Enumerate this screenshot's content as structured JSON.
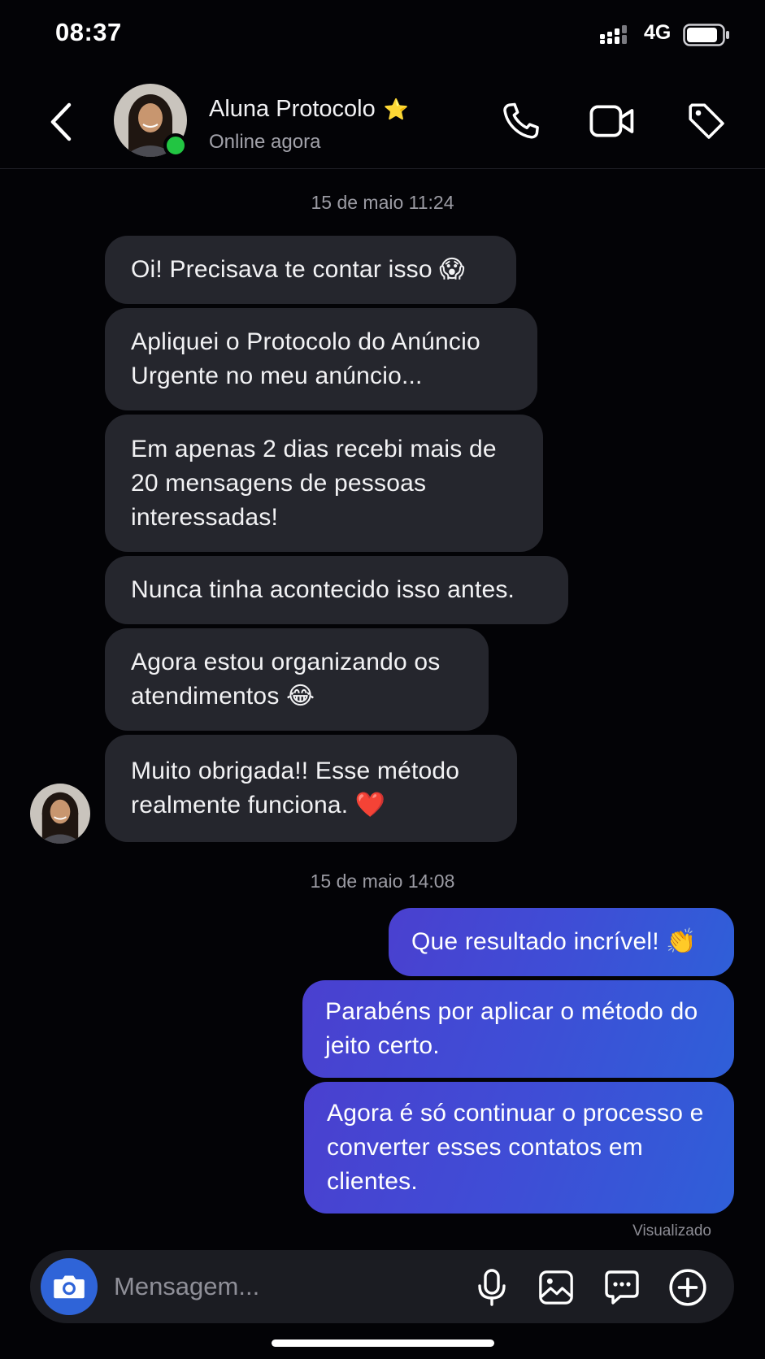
{
  "status_bar": {
    "time": "08:37",
    "network": "4G"
  },
  "header": {
    "contact_name": "Aluna Protocolo",
    "name_badge": "⭐",
    "status": "Online agora"
  },
  "conversation": {
    "date_1": "15 de maio 11:24",
    "incoming": [
      {
        "lines": [
          "Oi! Precisava te contar isso 😱"
        ]
      },
      {
        "lines": [
          "Apliquei o Protocolo do Anúncio",
          "Urgente no meu anúncio..."
        ]
      },
      {
        "lines": [
          "Em apenas 2 dias recebi mais de",
          "20 mensagens de pessoas",
          "interessadas!"
        ]
      },
      {
        "lines": [
          "Nunca tinha acontecido isso antes."
        ]
      },
      {
        "lines": [
          "Agora estou organizando os",
          "atendimentos 😂"
        ]
      },
      {
        "lines": [
          "Muito obrigada!! Esse método",
          "realmente funciona. ❤️"
        ]
      }
    ],
    "date_2": "15 de maio 14:08",
    "outgoing": [
      {
        "lines": [
          "Que resultado incrível! 👏"
        ]
      },
      {
        "lines": [
          "Parabéns por aplicar o método do",
          "jeito certo."
        ]
      },
      {
        "lines": [
          "Agora é só continuar o processo e",
          "converter esses contatos em",
          "clientes."
        ]
      }
    ],
    "seen_label": "Visualizado"
  },
  "composer": {
    "placeholder": "Mensagem..."
  },
  "colors": {
    "background": "#030306",
    "incoming_bubble": "#25262d",
    "outgoing_bubble_start": "#4a40cf",
    "outgoing_bubble_end": "#2f5fd8",
    "online_dot": "#22c542",
    "camera_button": "#2f64d8"
  },
  "icons": {
    "back": "chevron-left-icon",
    "call": "phone-icon",
    "video": "video-camera-icon",
    "tag": "tag-icon",
    "camera": "camera-icon",
    "mic": "microphone-icon",
    "gallery": "image-icon",
    "sticker": "message-dots-icon",
    "plus": "plus-circle-icon"
  }
}
